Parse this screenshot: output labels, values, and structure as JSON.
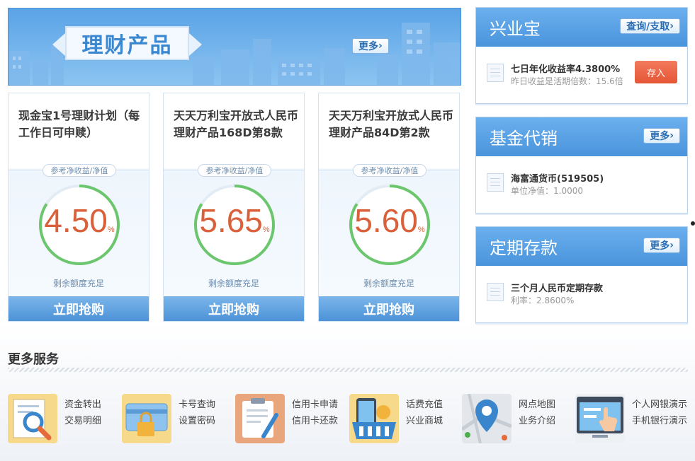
{
  "banner": {
    "title": "理财产品",
    "more_label": "更多"
  },
  "products": [
    {
      "title": "现金宝1号理财计划（每工作日可申赎）",
      "ref_label": "参考净收益/净值",
      "rate": "4.50",
      "rate_fraction": 0.84,
      "unit": "%",
      "remain": "剩余额度充足",
      "buy_label": "立即抢购"
    },
    {
      "title": "天天万利宝开放式人民币理财产品168D第8款",
      "ref_label": "参考净收益/净值",
      "rate": "5.65",
      "rate_fraction": 0.84,
      "unit": "%",
      "remain": "剩余额度充足",
      "buy_label": "立即抢购"
    },
    {
      "title": "天天万利宝开放式人民币理财产品84D第2款",
      "ref_label": "参考净收益/净值",
      "rate": "5.60",
      "rate_fraction": 0.84,
      "unit": "%",
      "remain": "剩余额度充足",
      "buy_label": "立即抢购"
    }
  ],
  "xingyebao": {
    "title": "兴业宝",
    "more_label": "查询/支取",
    "item_name": "七日年化收益率4.3800%",
    "item_sub": "昨日收益是活期倍数：15.6倍",
    "deposit_label": "存入"
  },
  "fund": {
    "title": "基金代销",
    "more_label": "更多",
    "item_name": "海富通货币(519505)",
    "item_sub": "单位净值：1.0000"
  },
  "deposit": {
    "title": "定期存款",
    "more_label": "更多",
    "item_name": "三个月人民币定期存款",
    "item_sub": "利率：2.8600%"
  },
  "services": {
    "title": "更多服务",
    "items": [
      {
        "icon": "magnifier-document-icon",
        "links": [
          "资金转出",
          "交易明细"
        ]
      },
      {
        "icon": "card-lock-icon",
        "links": [
          "卡号查询",
          "设置密码"
        ]
      },
      {
        "icon": "clipboard-pen-icon",
        "links": [
          "信用卡申请",
          "信用卡还款"
        ]
      },
      {
        "icon": "phone-basket-icon",
        "links": [
          "话费充值",
          "兴业商城"
        ]
      },
      {
        "icon": "map-pin-icon",
        "links": [
          "网点地图",
          "业务介绍"
        ]
      },
      {
        "icon": "screen-hand-icon",
        "links": [
          "个人网银演示",
          "手机银行演示"
        ]
      }
    ]
  },
  "colors": {
    "accent": "#4a94dc",
    "rate": "#d9603b",
    "gauge": "#6cc66d",
    "deposit_button": "#e45636"
  }
}
